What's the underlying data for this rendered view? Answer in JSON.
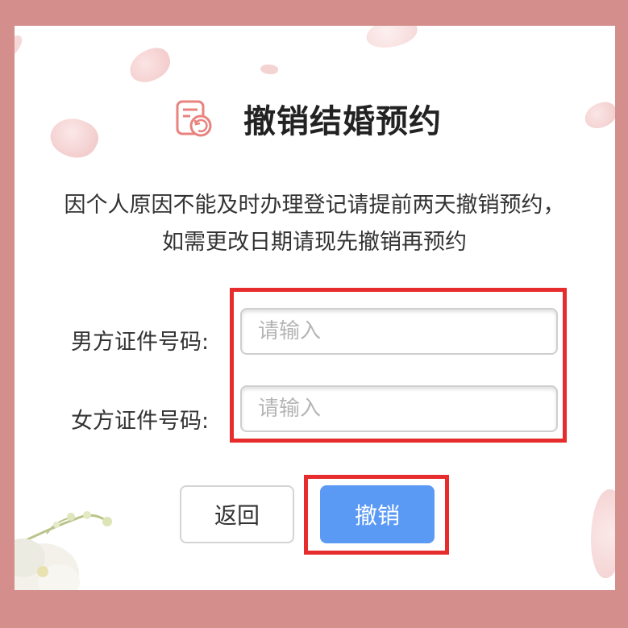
{
  "header": {
    "title": "撤销结婚预约",
    "icon": "calendar-undo-icon"
  },
  "description": "因个人原因不能及时办理登记请提前两天撤销预约，如需更改日期请现先撤销再预约",
  "form": {
    "male_id_label": "男方证件号码:",
    "male_id_placeholder": "请输入",
    "male_id_value": "",
    "female_id_label": "女方证件号码:",
    "female_id_placeholder": "请输入",
    "female_id_value": ""
  },
  "buttons": {
    "back_label": "返回",
    "cancel_label": "撤销"
  },
  "colors": {
    "background": "#d48f8d",
    "primary": "#5a9af5",
    "highlight": "#e62c2c",
    "icon": "#e8837f"
  }
}
